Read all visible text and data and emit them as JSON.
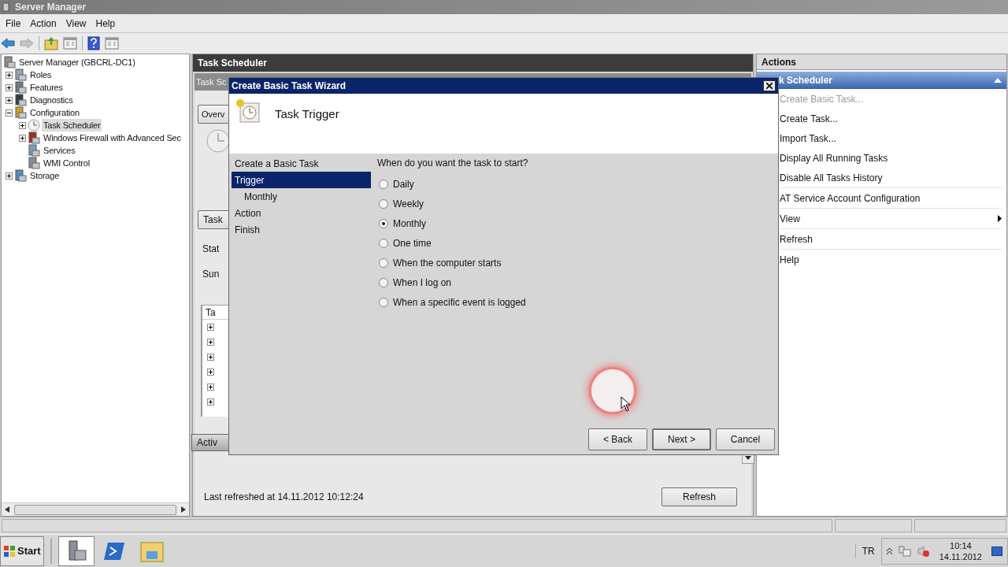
{
  "window": {
    "title": "Server Manager",
    "active": false
  },
  "menu": [
    "File",
    "Action",
    "View",
    "Help"
  ],
  "toolbar": [
    {
      "kind": "back",
      "disabled": false
    },
    {
      "kind": "forward",
      "disabled": true
    },
    {
      "kind": "up",
      "disabled": false
    },
    {
      "kind": "panel",
      "disabled": false
    },
    {
      "kind": "help",
      "disabled": false
    },
    {
      "kind": "panel",
      "disabled": false
    }
  ],
  "tree": [
    {
      "label": "Server Manager (GBCRL-DC1)",
      "selected": false,
      "children": [
        {
          "label": "Roles",
          "selected": false,
          "expanded": false
        },
        {
          "label": "Features",
          "selected": false,
          "expanded": false
        },
        {
          "label": "Diagnostics",
          "selected": false,
          "expanded": false
        },
        {
          "label": "Configuration",
          "selected": false,
          "expanded": true,
          "children": [
            {
              "label": "Task Scheduler",
              "selected": true,
              "expanded": false
            },
            {
              "label": "Windows Firewall with Advanced Sec",
              "selected": false,
              "expanded": false
            },
            {
              "label": "Services",
              "selected": false
            },
            {
              "label": "WMI Control",
              "selected": false
            }
          ]
        },
        {
          "label": "Storage",
          "selected": false,
          "expanded": false
        }
      ]
    }
  ],
  "center": {
    "header": "Task Scheduler",
    "subheader": "Task Sc",
    "overview_button": "Overv",
    "status_button": "Task",
    "labels": [
      "Stat",
      "Sun"
    ],
    "table": {
      "column_1": "Ta",
      "rows": [
        {
          "expanded": false
        },
        {
          "expanded": false
        },
        {
          "expanded": false
        },
        {
          "expanded": false
        },
        {
          "expanded": false
        },
        {
          "expanded": false
        }
      ]
    },
    "active_bar": "Activ",
    "last_refreshed": "Last refreshed at 14.11.2012 10:12:24",
    "refresh_button": "Refresh"
  },
  "dialog": {
    "title": "Create Basic Task Wizard",
    "heading": "Task Trigger",
    "steps": [
      {
        "label": "Create a Basic Task",
        "selected": false
      },
      {
        "label": "Trigger",
        "selected": true,
        "children": [
          {
            "label": "Monthly",
            "selected": false
          }
        ]
      },
      {
        "label": "Action",
        "selected": false
      },
      {
        "label": "Finish",
        "selected": false
      }
    ],
    "question": "When do you want the task to start?",
    "options": [
      {
        "label": "Daily",
        "selected": false
      },
      {
        "label": "Weekly",
        "selected": false
      },
      {
        "label": "Monthly",
        "selected": true
      },
      {
        "label": "One time",
        "selected": false
      },
      {
        "label": "When the computer starts",
        "selected": false
      },
      {
        "label": "When I log on",
        "selected": false
      },
      {
        "label": "When a specific event is logged",
        "selected": false
      }
    ],
    "buttons": [
      {
        "label": "< Back",
        "default": false
      },
      {
        "label": "Next >",
        "default": true
      },
      {
        "label": "Cancel",
        "default": false
      }
    ]
  },
  "actions": {
    "header": "Actions",
    "section": {
      "label": "k Scheduler",
      "expanded": true
    },
    "groups": [
      [
        {
          "label": "Create Basic Task...",
          "disabled": true,
          "kind": "command"
        },
        {
          "label": "Create Task...",
          "disabled": false,
          "kind": "command"
        },
        {
          "label": "Import Task...",
          "disabled": false,
          "kind": "command"
        },
        {
          "label": "Display All Running Tasks",
          "disabled": false,
          "kind": "command"
        },
        {
          "label": "Disable All Tasks History",
          "disabled": false,
          "kind": "command"
        }
      ],
      [
        {
          "label": "AT Service Account Configuration",
          "disabled": false,
          "kind": "command"
        }
      ],
      [
        {
          "label": "View",
          "disabled": false,
          "kind": "submenu"
        }
      ],
      [
        {
          "label": "Refresh",
          "disabled": false,
          "kind": "command"
        }
      ],
      [
        {
          "label": "Help",
          "disabled": false,
          "kind": "command"
        }
      ]
    ]
  },
  "taskbar": {
    "start": "Start",
    "apps": [
      {
        "selected": true
      },
      {
        "selected": false
      },
      {
        "selected": false
      }
    ],
    "language": "TR",
    "time": "10:14",
    "date": "14.11.2012"
  }
}
